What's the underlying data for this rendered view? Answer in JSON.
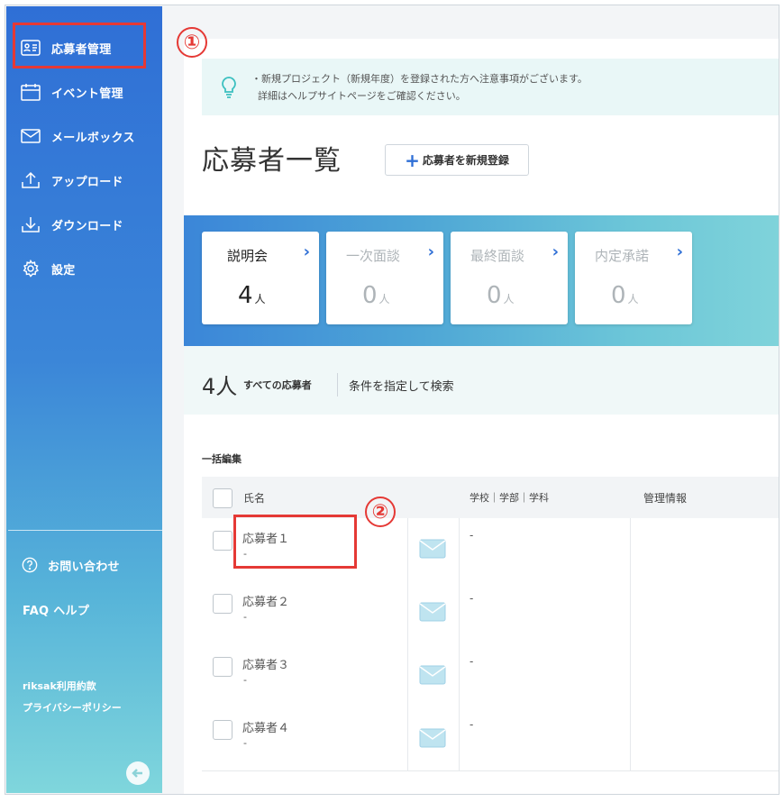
{
  "sidebar": {
    "items": [
      {
        "label": "応募者管理",
        "icon": "id-card-icon"
      },
      {
        "label": "イベント管理",
        "icon": "calendar-icon"
      },
      {
        "label": "メールボックス",
        "icon": "envelope-icon"
      },
      {
        "label": "アップロード",
        "icon": "upload-icon"
      },
      {
        "label": "ダウンロード",
        "icon": "download-icon"
      },
      {
        "label": "設定",
        "icon": "gear-icon"
      }
    ],
    "contact_label": "お問い合わせ",
    "faq_label": "FAQ ヘルプ",
    "terms_label": "riksak利用約款",
    "privacy_label": "プライバシーポリシー"
  },
  "notice": {
    "line1": "・新規プロジェクト（新規年度）を登録された方へ注意事項がございます。",
    "line2": "詳細はヘルプサイトページをご確認ください。"
  },
  "page": {
    "title": "応募者一覧",
    "register_button": "応募者を新規登録"
  },
  "stages": [
    {
      "name": "説明会",
      "count": "4",
      "unit": "人",
      "active": true
    },
    {
      "name": "一次面談",
      "count": "0",
      "unit": "人",
      "active": false
    },
    {
      "name": "最終面談",
      "count": "0",
      "unit": "人",
      "active": false
    },
    {
      "name": "内定承諾",
      "count": "0",
      "unit": "人",
      "active": false
    }
  ],
  "summary": {
    "total": "4人",
    "total_label": "すべての応募者",
    "search_link": "条件を指定して検索"
  },
  "table": {
    "bulk_edit": "一括編集",
    "headers": {
      "name": "氏名",
      "school": "学校｜学部｜学科",
      "mgmt": "管理情報"
    },
    "rows": [
      {
        "name": "応募者１",
        "sub": "-",
        "school": "-"
      },
      {
        "name": "応募者２",
        "sub": "-",
        "school": "-"
      },
      {
        "name": "応募者３",
        "sub": "-",
        "school": "-"
      },
      {
        "name": "応募者４",
        "sub": "-",
        "school": "-"
      }
    ]
  },
  "callouts": {
    "one": "①",
    "two": "②"
  },
  "colors": {
    "primary": "#2f6fd6",
    "accent_red": "#e53935",
    "teal": "#7fd3da"
  }
}
